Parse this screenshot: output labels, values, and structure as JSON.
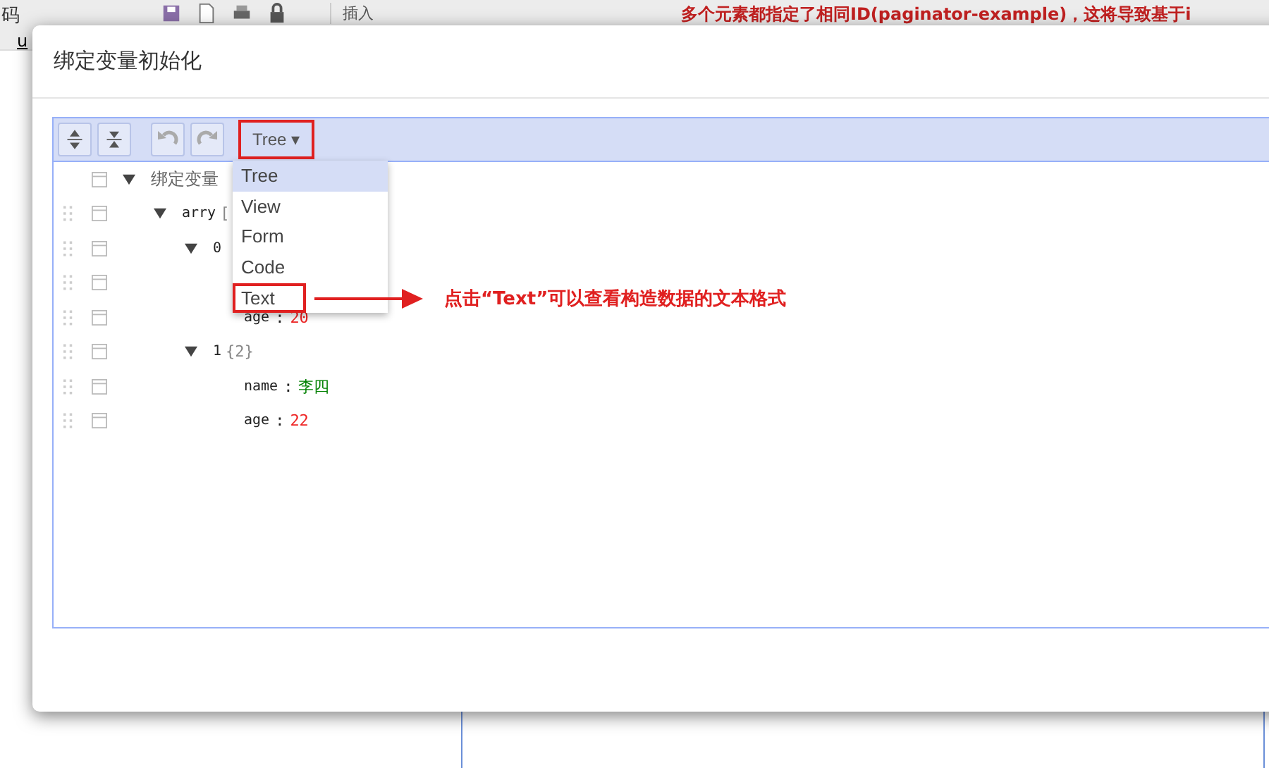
{
  "background": {
    "corner_text": "码",
    "insert_select": "插入",
    "error_message": "多个元素都指定了相同ID(paginator-example)，这将导致基于i",
    "side_text": "u"
  },
  "dialog": {
    "title": "绑定变量初始化"
  },
  "editor": {
    "mode_button": "Tree ▾",
    "mode_menu": [
      {
        "label": "Tree",
        "selected": true,
        "highlighted": false
      },
      {
        "label": "View",
        "selected": false,
        "highlighted": false
      },
      {
        "label": "Form",
        "selected": false,
        "highlighted": false
      },
      {
        "label": "Code",
        "selected": false,
        "highlighted": false
      },
      {
        "label": "Text",
        "selected": false,
        "highlighted": true
      }
    ],
    "tree": [
      {
        "key": "绑定变量",
        "expanded": true,
        "children": [
          {
            "key": "arry",
            "count": "[",
            "expanded": true,
            "children": [
              {
                "key": "0",
                "expanded": true,
                "children": [
                  {
                    "kind": "hidden"
                  },
                  {
                    "kind": "field",
                    "key": "age",
                    "separator": ":",
                    "value": "20",
                    "color": "#ee2222"
                  }
                ]
              },
              {
                "key": "1",
                "count": "{2}",
                "expanded": true,
                "children": [
                  {
                    "kind": "field",
                    "key": "name",
                    "separator": ":",
                    "value": "李四",
                    "color": "#008000"
                  },
                  {
                    "kind": "field",
                    "key": "age",
                    "separator": ":",
                    "value": "22",
                    "color": "#ee2222"
                  }
                ]
              }
            ]
          }
        ]
      }
    ]
  },
  "annotation": {
    "text": "点击“Text”可以查看构造数据的文本格式"
  }
}
